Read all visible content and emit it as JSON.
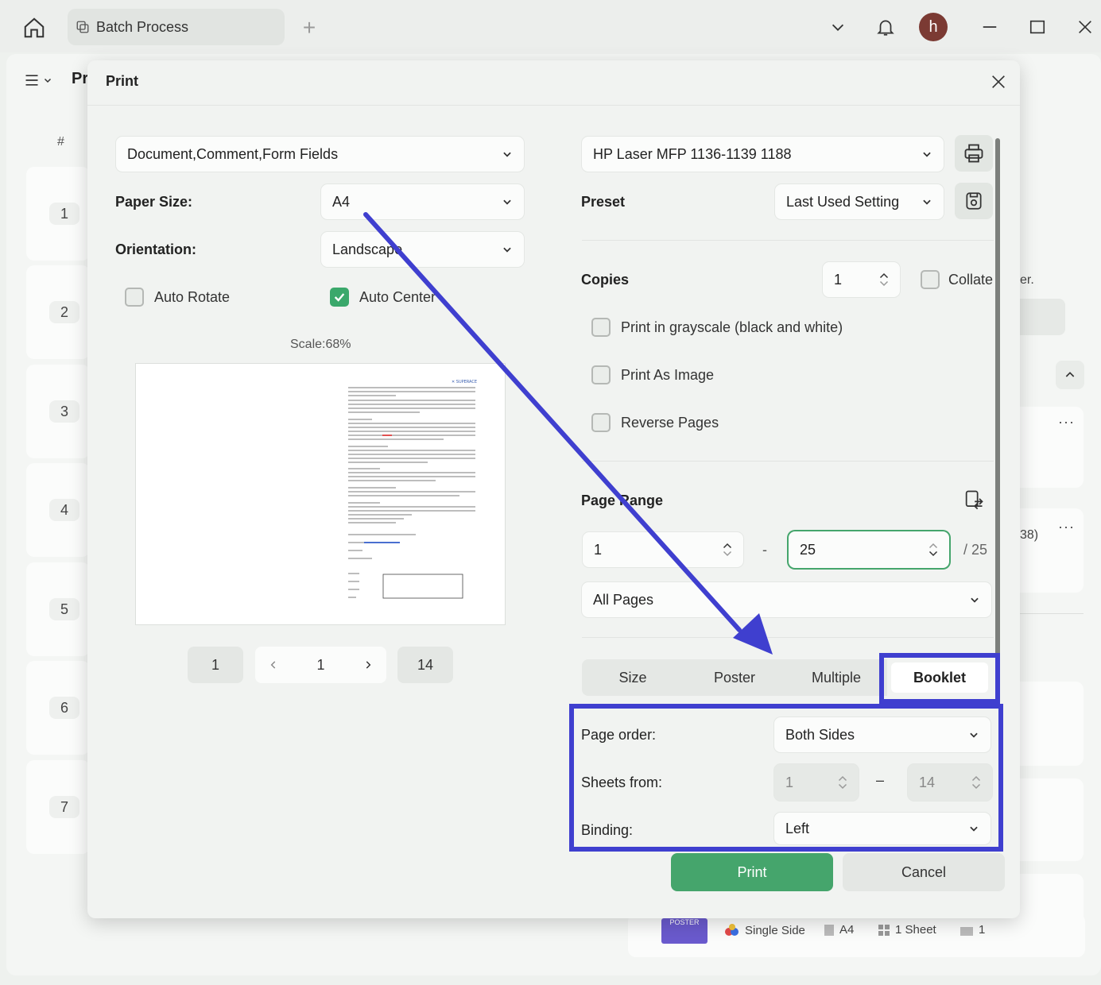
{
  "titlebar": {
    "tab_label": "Batch Process",
    "avatar_letter": "h"
  },
  "background": {
    "title_partial": "Pr",
    "hash": "#",
    "rows": [
      "1",
      "2",
      "3",
      "4",
      "5",
      "6",
      "7"
    ],
    "side_text_1": "er.",
    "side_text_2": "38)",
    "dots": "···",
    "bottom": {
      "poster_thumb": "POSTER",
      "sides": "Single Side",
      "paper": "A4",
      "sheets": "1 Sheet",
      "count": "1"
    }
  },
  "dialog": {
    "title": "Print",
    "content_select": "Document,Comment,Form Fields",
    "paper_size_label": "Paper Size:",
    "paper_size_value": "A4",
    "orientation_label": "Orientation:",
    "orientation_value": "Landscape",
    "auto_rotate_label": "Auto Rotate",
    "auto_center_label": "Auto Center",
    "scale_label": "Scale:68%",
    "pager": {
      "first": "1",
      "current": "1",
      "last": "14"
    },
    "printer": "HP Laser MFP 1136-1139 1188",
    "preset_label": "Preset",
    "preset_value": "Last Used Setting",
    "copies_label": "Copies",
    "copies_value": "1",
    "collate_label": "Collate",
    "grayscale_label": "Print in grayscale (black and white)",
    "print_image_label": "Print As Image",
    "reverse_label": "Reverse Pages",
    "page_range_label": "Page Range",
    "range_from": "1",
    "range_dash": "-",
    "range_to": "25",
    "range_total": "/ 25",
    "pages_select": "All Pages",
    "tabs": [
      "Size",
      "Poster",
      "Multiple",
      "Booklet"
    ],
    "page_order_label": "Page order:",
    "page_order_value": "Both Sides",
    "sheets_from_label": "Sheets from:",
    "sheets_from_value": "1",
    "sheets_dash": "–",
    "sheets_to_value": "14",
    "binding_label": "Binding:",
    "binding_value": "Left",
    "print_button": "Print",
    "cancel_button": "Cancel"
  },
  "colors": {
    "accent_green": "#45a56c",
    "highlight_blue": "#3f3fcf",
    "avatar": "#7b3a33"
  }
}
